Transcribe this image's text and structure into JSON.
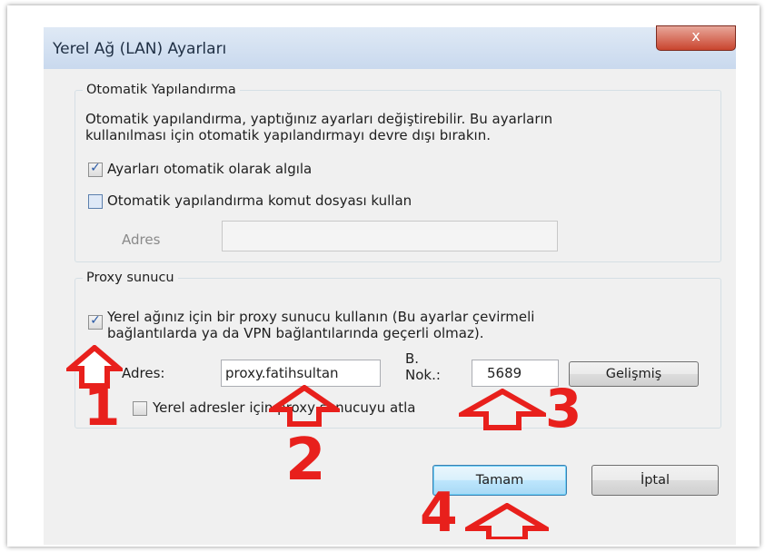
{
  "dialog": {
    "title": "Yerel Ağ (LAN) Ayarları",
    "close_glyph": "x"
  },
  "auto_config": {
    "legend": "Otomatik Yapılandırma",
    "description_line1": "Otomatik yapılandırma, yaptığınız ayarları değiştirebilir. Bu ayarların",
    "description_line2": "kullanılması için otomatik yapılandırmayı devre dışı bırakın.",
    "auto_detect_label": "Ayarları otomatik olarak algıla",
    "auto_detect_checked": true,
    "script_label": "Otomatik yapılandırma komut dosyası kullan",
    "script_checked": false,
    "address_label": "Adres",
    "address_value": ""
  },
  "proxy": {
    "legend": "Proxy sunucu",
    "use_proxy_line1": "Yerel ağınız için bir proxy sunucu kullanın (Bu ayarlar çevirmeli",
    "use_proxy_line2": "bağlantılarda ya da VPN bağlantılarında geçerli olmaz).",
    "use_proxy_checked": true,
    "address_label": "Adres:",
    "address_value": "proxy.fatihsultan",
    "port_label_line1": "B.",
    "port_label_line2": "Nok.:",
    "port_value": "5689",
    "advanced_button": "Gelişmiş",
    "bypass_label": "Yerel adresler için proxy sunucuyu atla",
    "bypass_checked": false
  },
  "buttons": {
    "ok": "Tamam",
    "cancel": "İptal"
  },
  "annotations": {
    "step1": "1",
    "step2": "2",
    "step3": "3",
    "step4": "4",
    "color": "#e8201c"
  },
  "icons": {
    "check": "✓",
    "arrow": "up-arrow-outline"
  }
}
